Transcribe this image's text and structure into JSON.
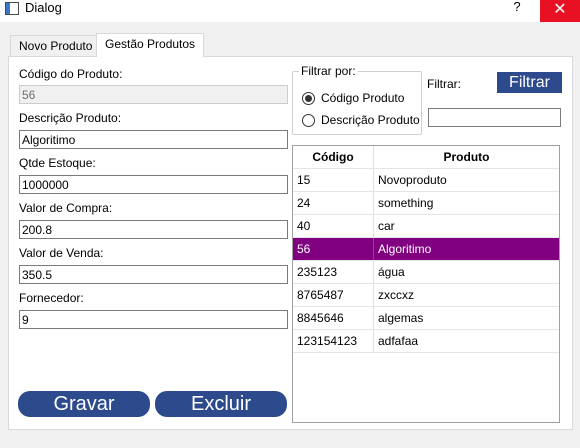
{
  "window": {
    "title": "Dialog",
    "help": "?",
    "close": "✕"
  },
  "tabs": [
    {
      "label": "Novo Produto"
    },
    {
      "label": "Gestão Produtos"
    }
  ],
  "form": {
    "codigo_label": "Código do Produto:",
    "codigo_value": "56",
    "descricao_label": "Descrição Produto:",
    "descricao_value": "Algoritimo",
    "estoque_label": "Qtde Estoque:",
    "estoque_value": "1000000",
    "compra_label": "Valor de Compra:",
    "compra_value": "200.8",
    "venda_label": "Valor de Venda:",
    "venda_value": "350.5",
    "fornecedor_label": "Fornecedor:",
    "fornecedor_value": "9"
  },
  "filter": {
    "group_title": "Filtrar por:",
    "option_codigo": "Código Produto",
    "option_descricao": "Descrição Produto",
    "selected": "codigo",
    "filtrar_label": "Filtrar:",
    "filtrar_value": "",
    "filtrar_button": "Filtrar"
  },
  "table": {
    "headers": [
      "Código",
      "Produto"
    ],
    "rows": [
      {
        "codigo": "15",
        "produto": "Novoproduto"
      },
      {
        "codigo": "24",
        "produto": "something"
      },
      {
        "codigo": "40",
        "produto": "car"
      },
      {
        "codigo": "56",
        "produto": "Algoritimo"
      },
      {
        "codigo": "235123",
        "produto": "água"
      },
      {
        "codigo": "8765487",
        "produto": "zxccxz"
      },
      {
        "codigo": "8845646",
        "produto": "algemas"
      },
      {
        "codigo": "123154123",
        "produto": "adfafaa"
      }
    ],
    "selected_index": 3
  },
  "actions": {
    "gravar": "Gravar",
    "excluir": "Excluir"
  },
  "colors": {
    "accent_button": "#2c4a8c",
    "selection": "#800080",
    "close_button": "#e81123"
  }
}
